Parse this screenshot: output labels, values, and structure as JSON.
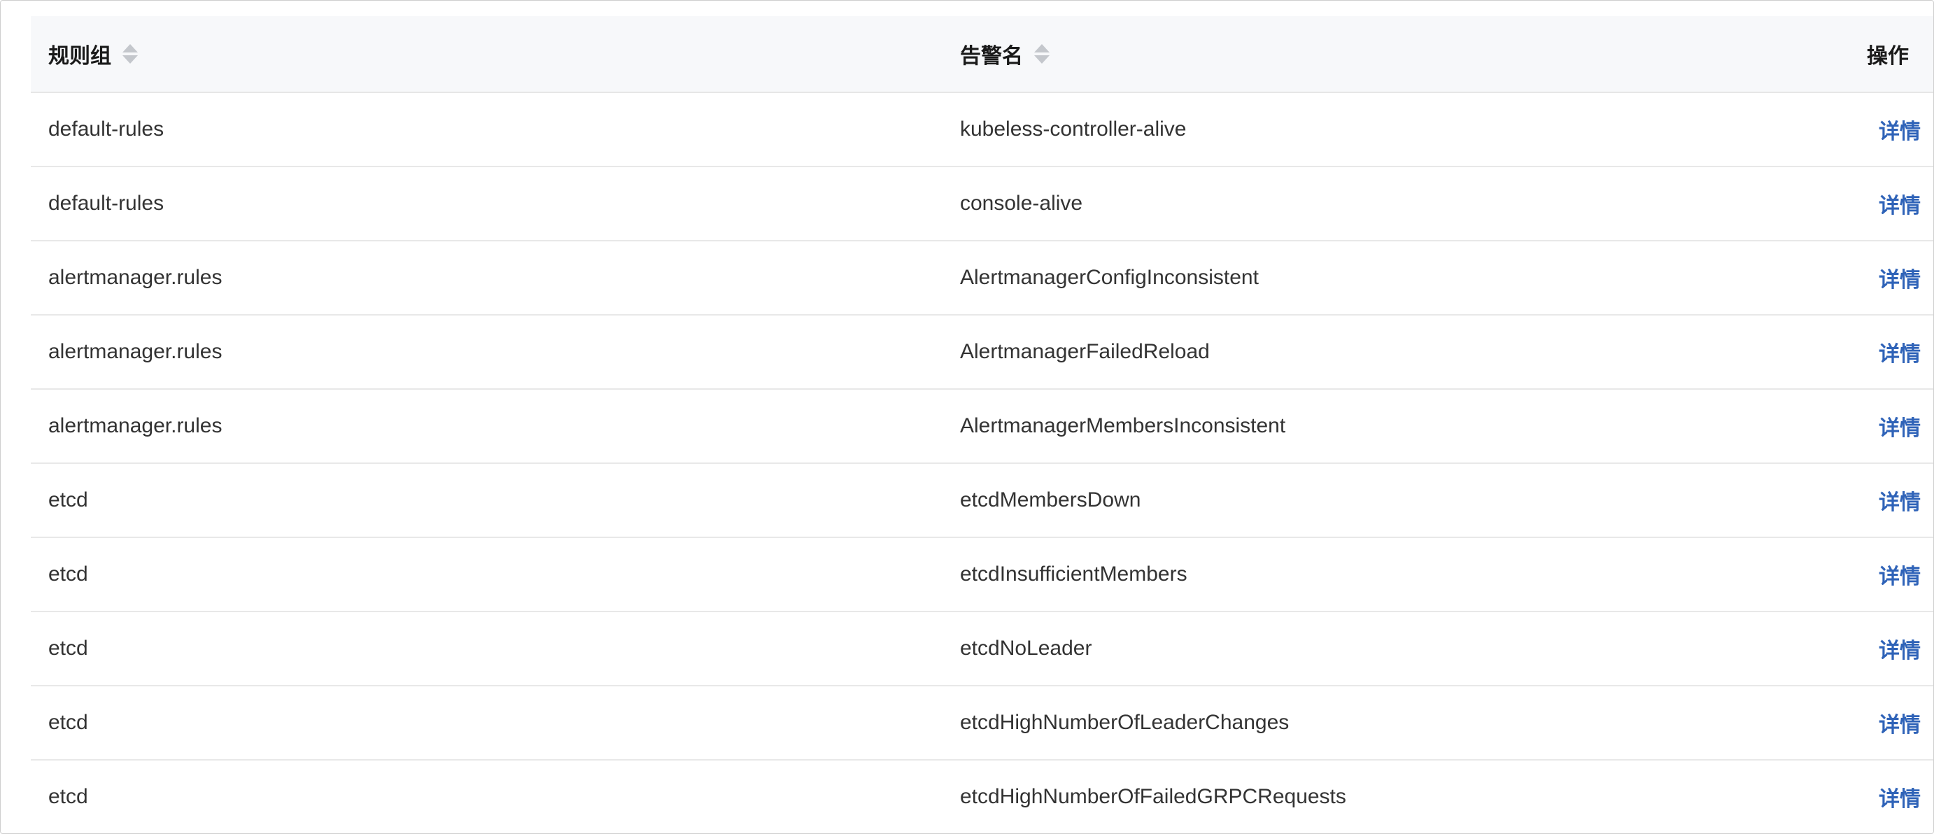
{
  "table": {
    "columns": {
      "rule_group": "规则组",
      "alert_name": "告警名",
      "action": "操作"
    },
    "rows": [
      {
        "rule_group": "default-rules",
        "alert_name": "kubeless-controller-alive",
        "action": "详情"
      },
      {
        "rule_group": "default-rules",
        "alert_name": "console-alive",
        "action": "详情"
      },
      {
        "rule_group": "alertmanager.rules",
        "alert_name": "AlertmanagerConfigInconsistent",
        "action": "详情"
      },
      {
        "rule_group": "alertmanager.rules",
        "alert_name": "AlertmanagerFailedReload",
        "action": "详情"
      },
      {
        "rule_group": "alertmanager.rules",
        "alert_name": "AlertmanagerMembersInconsistent",
        "action": "详情"
      },
      {
        "rule_group": "etcd",
        "alert_name": "etcdMembersDown",
        "action": "详情"
      },
      {
        "rule_group": "etcd",
        "alert_name": "etcdInsufficientMembers",
        "action": "详情"
      },
      {
        "rule_group": "etcd",
        "alert_name": "etcdNoLeader",
        "action": "详情"
      },
      {
        "rule_group": "etcd",
        "alert_name": "etcdHighNumberOfLeaderChanges",
        "action": "详情"
      },
      {
        "rule_group": "etcd",
        "alert_name": "etcdHighNumberOfFailedGRPCRequests",
        "action": "详情"
      }
    ]
  },
  "colors": {
    "link": "#2f63b8",
    "header_bg": "#f7f8fa",
    "divider": "#e8e8e8"
  },
  "icons": {
    "sort": "sort-icon"
  }
}
